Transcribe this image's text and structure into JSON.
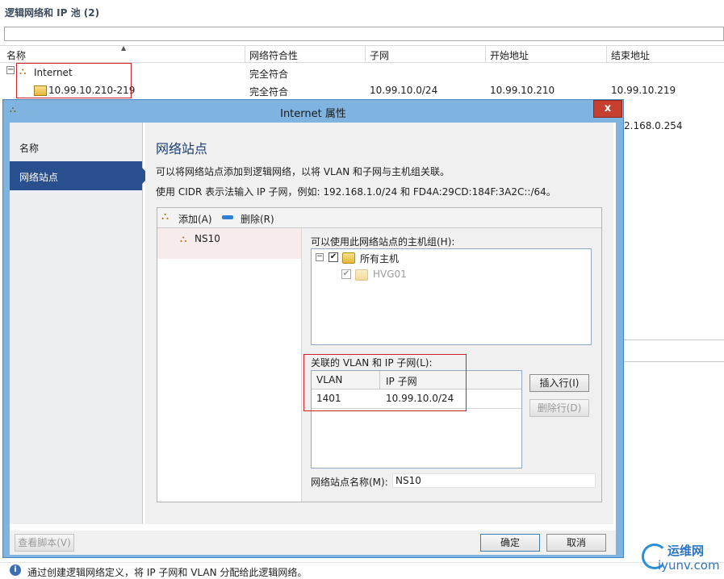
{
  "background": {
    "title": "逻辑网络和 IP 池 (2)",
    "filter_value": "",
    "columns": [
      "名称",
      "网络符合性",
      "子网",
      "开始地址",
      "结束地址"
    ],
    "rows": [
      {
        "name": "Internet",
        "compliance": "完全符合",
        "subnet": "",
        "start": "",
        "end": ""
      },
      {
        "name": "10.99.10.210-219",
        "compliance": "完全符合",
        "subnet": "10.99.10.0/24",
        "start": "10.99.10.210",
        "end": "10.99.10.219"
      }
    ],
    "partial_end_address": "2.168.0.254"
  },
  "dialog": {
    "title": "Internet 属性",
    "close_label": "x",
    "nav": [
      {
        "label": "名称"
      },
      {
        "label": "网络站点"
      }
    ],
    "heading": "网络站点",
    "desc1": "可以将网络站点添加到逻辑网络，以将 VLAN 和子网与主机组关联。",
    "desc2": "使用 CIDR 表示法输入 IP 子网，例如: 192.168.1.0/24 和 FD4A:29CD:184F:3A2C::/64。",
    "toolbar": {
      "add_label": "添加(A)",
      "delete_label": "删除(R)"
    },
    "sites": [
      {
        "name": "NS10"
      }
    ],
    "host_groups_label": "可以使用此网络站点的主机组(H):",
    "host_tree": [
      {
        "label": "所有主机",
        "checked": "✔"
      },
      {
        "label": "HVG01",
        "checked": "✔"
      }
    ],
    "vlan_label": "关联的 VLAN 和 IP 子网(L):",
    "vlan_columns": [
      "VLAN",
      "IP 子网"
    ],
    "vlan_rows": [
      {
        "vlan": "1401",
        "subnet": "10.99.10.0/24"
      }
    ],
    "insert_row_label": "插入行(I)",
    "delete_row_label": "删除行(D)",
    "site_name_label": "网络站点名称(M):",
    "site_name_value": "NS10",
    "view_script_label": "查看脚本(V)",
    "ok_label": "确定",
    "cancel_label": "取消"
  },
  "status_bar": {
    "text": "通过创建逻辑网络定义，将 IP 子网和 VLAN 分配给此逻辑网络。",
    "info_icon": "i"
  },
  "watermark": {
    "cn": "运维网",
    "en": "iyunv.com"
  },
  "colors": {
    "accent": "#2a4f8e",
    "title_bar": "#7fb4e0",
    "highlight_box": "#d0202a",
    "close": "#c7402f"
  }
}
